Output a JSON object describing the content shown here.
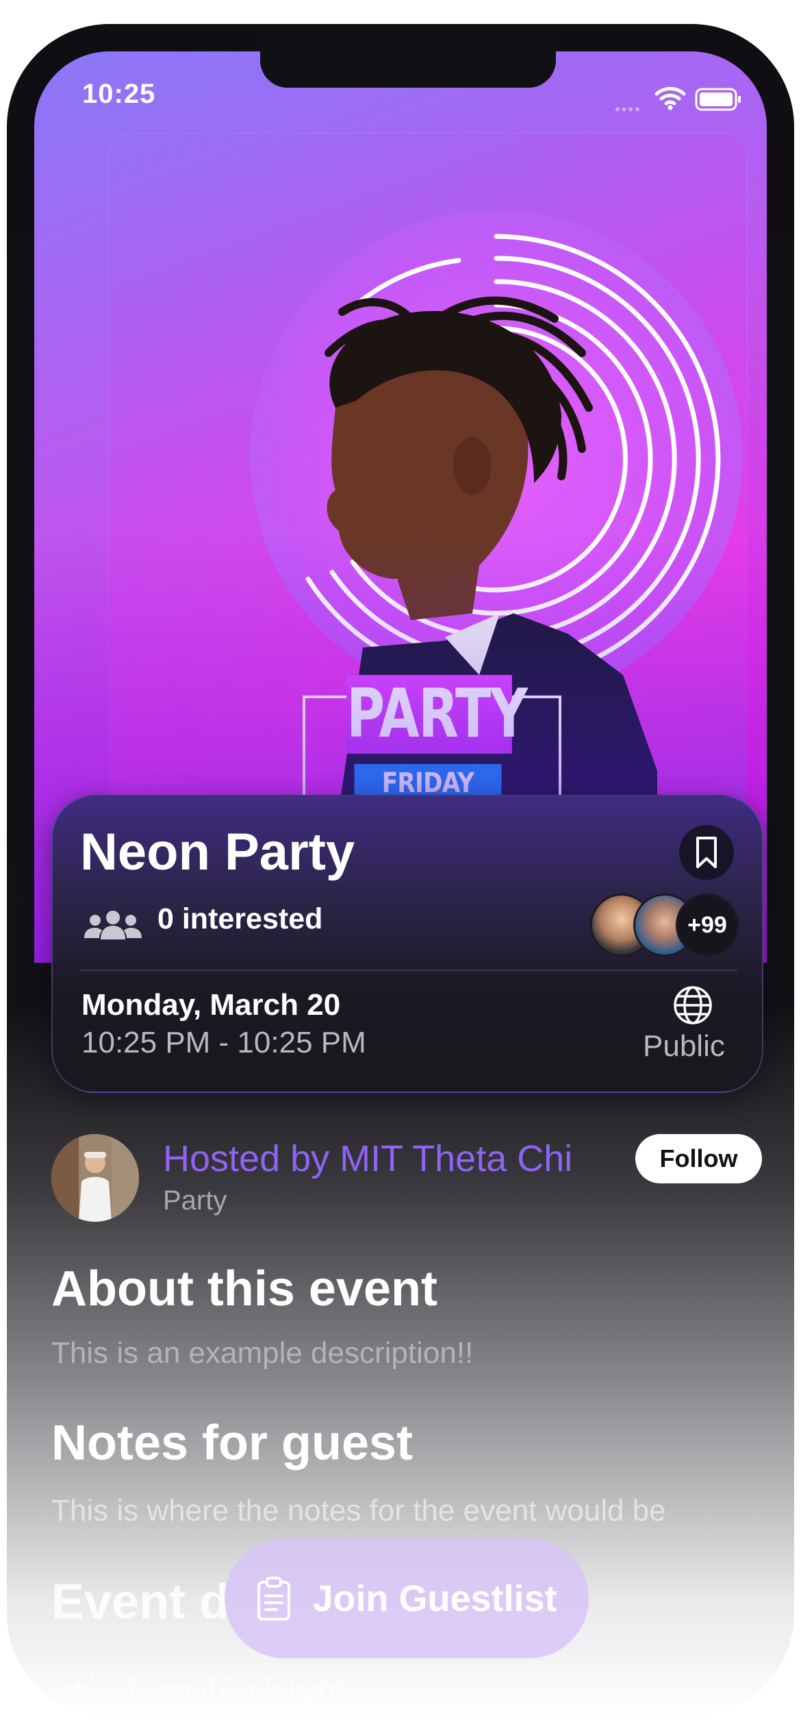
{
  "status_bar": {
    "time": "10:25"
  },
  "poster": {
    "headline": "PARTY",
    "subline": "FRIDAY NIGHT"
  },
  "event": {
    "title": "Neon Party",
    "interested": "0 interested",
    "attendee_overflow": "+99",
    "date": "Monday, March 20",
    "time_range": "10:25 PM - 10:25 PM",
    "visibility": "Public"
  },
  "host": {
    "label": "Hosted by MIT Theta Chi",
    "category": "Party",
    "follow_label": "Follow"
  },
  "about": {
    "heading": "About this event",
    "text": "This is an example description!!"
  },
  "notes": {
    "heading": "Notes for guest",
    "text": "This is where the notes for the event would be"
  },
  "details": {
    "heading": "Event d",
    "items": [
      {
        "label": "Neon/black light",
        "icon": "sparkles-icon"
      }
    ]
  },
  "cta": {
    "label": "Join Guestlist",
    "icon": "clipboard-icon"
  },
  "colors": {
    "accent": "#8f63f3",
    "poster_pink": "#ff19db",
    "poster_purple": "#8a78f8"
  }
}
